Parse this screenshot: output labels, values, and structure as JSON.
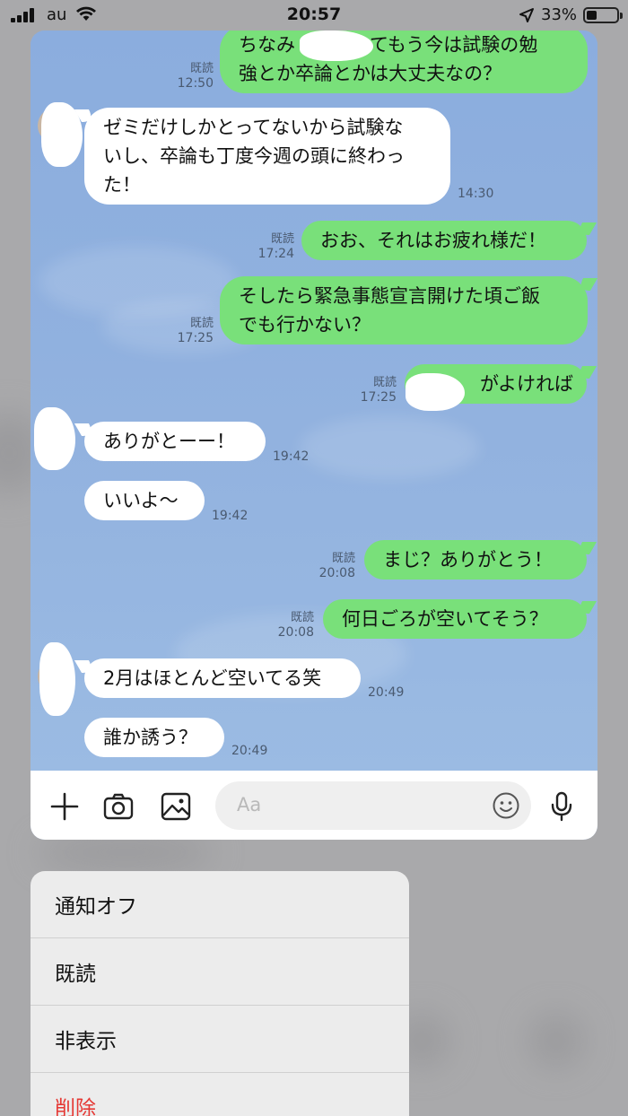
{
  "status_bar": {
    "carrier": "au",
    "time": "20:57",
    "battery_percent": "33%",
    "battery_level": 0.33
  },
  "chat": {
    "messages": [
      {
        "dir": "out",
        "text": "ちなみ　　　ってもう今は試験の勉\n強とか卒論とかは大丈夫なの？",
        "read": "既読",
        "time": "12:50"
      },
      {
        "dir": "in",
        "text": "ゼミだけしかとってないから試験な\nいし、卒論も丁度今週の頭に終わっ\nた！",
        "time": "14:30"
      },
      {
        "dir": "out",
        "text": "おお、それはお疲れ様だ！",
        "read": "既読",
        "time": "17:24"
      },
      {
        "dir": "out",
        "text": "そしたら緊急事態宣言開けた頃ご飯\nでも行かない？",
        "read": "既読",
        "time": "17:25"
      },
      {
        "dir": "out",
        "text": "　　　がよければ",
        "read": "既読",
        "time": "17:25"
      },
      {
        "dir": "in",
        "text": "ありがとーー！",
        "time": "19:42"
      },
      {
        "dir": "in",
        "text": "いいよ〜",
        "time": "19:42"
      },
      {
        "dir": "out",
        "text": "まじ？ありがとう！",
        "read": "既読",
        "time": "20:08"
      },
      {
        "dir": "out",
        "text": "何日ごろが空いてそう？",
        "read": "既読",
        "time": "20:08"
      },
      {
        "dir": "in",
        "text": "2月はほとんど空いてる笑",
        "time": "20:49"
      },
      {
        "dir": "in",
        "text": "誰か誘う？",
        "time": "20:49"
      }
    ]
  },
  "input_bar": {
    "placeholder": "Aa",
    "icons": [
      "plus-icon",
      "camera-icon",
      "image-icon",
      "emoji-icon",
      "microphone-icon"
    ]
  },
  "context_menu": {
    "items": [
      {
        "label": "通知オフ"
      },
      {
        "label": "既読"
      },
      {
        "label": "非表示"
      },
      {
        "label": "削除"
      }
    ]
  },
  "colors": {
    "outgoing_bubble": "#79e07a",
    "incoming_bubble": "#ffffff",
    "chat_background": "#8fafde",
    "danger": "#e53935"
  }
}
